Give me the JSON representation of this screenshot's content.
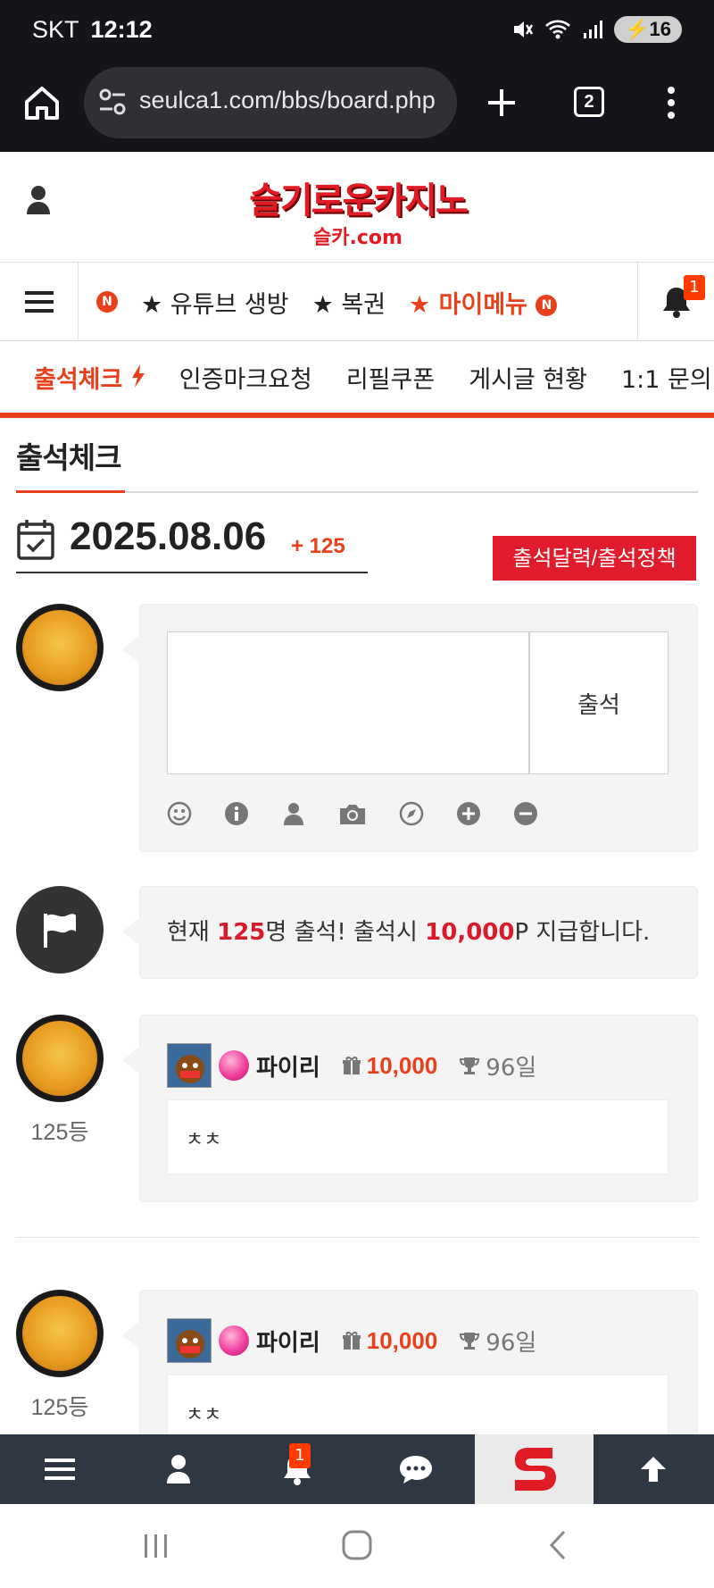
{
  "status_bar": {
    "carrier": "SKT",
    "time": "12:12",
    "battery": "16"
  },
  "browser": {
    "url": "seulca1.com/bbs/board.php",
    "tab_count": "2"
  },
  "site": {
    "logo_main": "슬기로운카지노",
    "logo_sub": "슬카.com"
  },
  "main_nav": {
    "n_badge": "N",
    "items": [
      "★ 유튜브 생방",
      "★ 복권",
      "★ 마이메뉴"
    ],
    "bell_count": "1"
  },
  "sub_nav": {
    "items": [
      "출석체크",
      "인증마크요청",
      "리필쿠폰",
      "게시글 현황",
      "1:1 문의"
    ]
  },
  "page": {
    "title": "출석체크",
    "date": "2025.08.06",
    "count": "+ 125",
    "policy_button": "출석달력/출석정책"
  },
  "composer": {
    "submit": "출석"
  },
  "notice": {
    "prefix": "현재 ",
    "count": "125",
    "mid": "명 출석! 출석시 ",
    "points": "10,000",
    "suffix": "P 지급합니다."
  },
  "entries": [
    {
      "rank": "125등",
      "nickname": "파이리",
      "points": "10,000",
      "days": "96일",
      "message": "ㅊㅊ"
    },
    {
      "rank": "125등",
      "nickname": "파이리",
      "points": "10,000",
      "days": "96일",
      "message": "ㅊㅊ"
    }
  ],
  "bottom_bar": {
    "alert_count": "1"
  },
  "colors": {
    "accent": "#e8401b",
    "highlight": "#d91a2a",
    "dark_bar": "#2f3742"
  }
}
